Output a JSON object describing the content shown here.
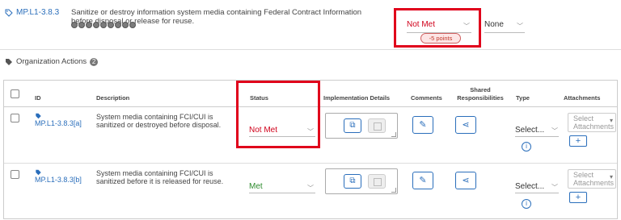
{
  "control": {
    "id": "MP.L1-3.8.3",
    "description": "Sanitize or destroy information system media containing Federal Contract Information before disposal or release for reuse.",
    "status": "Not Met",
    "points": "-5 points",
    "secondary": "None"
  },
  "org_actions": {
    "label": "Organization Actions",
    "count": "2"
  },
  "table": {
    "headers": {
      "id": "ID",
      "description": "Description",
      "status": "Status",
      "implementation": "Implementation Details",
      "comments": "Comments",
      "shared": "Shared Responsibilities",
      "type": "Type",
      "attachments": "Attachments"
    },
    "rows": [
      {
        "id": "MP.L1-3.8.3[a]",
        "description": "System media containing FCI/CUI is sanitized or destroyed before disposal.",
        "status": "Not Met",
        "status_color": "#d0021b",
        "type": "Select...",
        "attachments": "Select Attachments"
      },
      {
        "id": "MP.L1-3.8.3[b]",
        "description": "System media containing FCI/CUI is sanitized before it is released for reuse.",
        "status": "Met",
        "status_color": "#2e8b2e",
        "type": "Select...",
        "attachments": "Select Attachments"
      }
    ]
  },
  "colors": {
    "accent": "#2a6ebb",
    "highlight": "#e0001b"
  }
}
